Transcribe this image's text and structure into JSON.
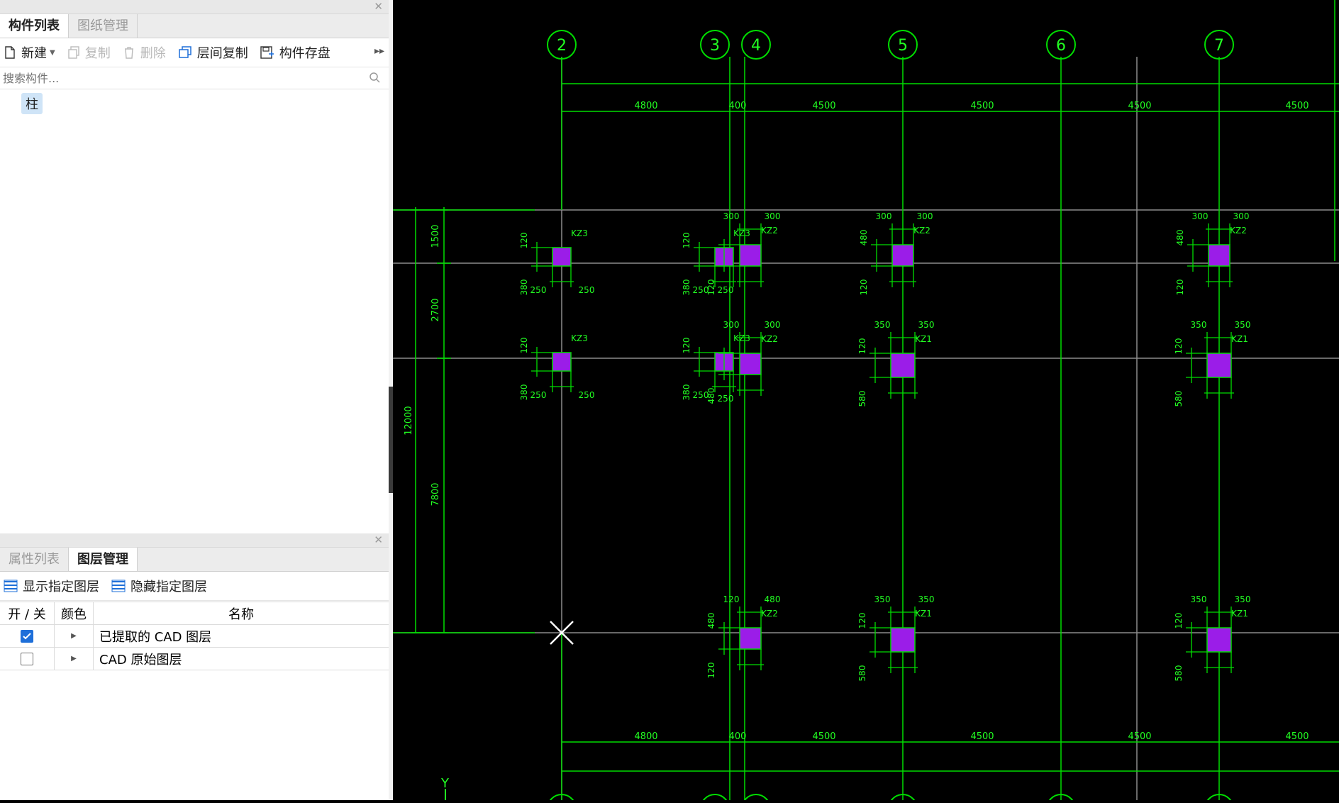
{
  "top_panel": {
    "tabs": [
      {
        "label": "构件列表",
        "active": true
      },
      {
        "label": "图纸管理",
        "active": false
      }
    ],
    "toolbar": {
      "new": "新建",
      "copy": "复制",
      "delete": "删除",
      "floor_copy": "层间复制",
      "save_component": "构件存盘"
    },
    "search_placeholder": "搜索构件...",
    "tree_item": "柱"
  },
  "bottom_panel": {
    "tabs": [
      {
        "label": "属性列表",
        "active": false
      },
      {
        "label": "图层管理",
        "active": true
      }
    ],
    "toolbar": {
      "show_layer": "显示指定图层",
      "hide_layer": "隐藏指定图层"
    },
    "table": {
      "headers": {
        "toggle": "开 / 关",
        "color": "颜色",
        "name": "名称"
      },
      "rows": [
        {
          "name": "已提取的 CAD 图层",
          "checked": true
        },
        {
          "name": "CAD 原始图层",
          "checked": false
        }
      ]
    }
  },
  "cad": {
    "axes": [
      "2",
      "3",
      "4",
      "5",
      "6",
      "7"
    ],
    "dims_top": [
      "4800",
      "400",
      "4500",
      "4500",
      "4500",
      "4500"
    ],
    "dims_bottom": [
      "4800",
      "400",
      "4500",
      "4500",
      "4500",
      "4500"
    ],
    "dims_left": [
      "1500",
      "2700",
      "12000",
      "7800"
    ],
    "y_label": "Y",
    "labels": {
      "n120": "120",
      "n250": "250",
      "n300": "300",
      "n350": "350",
      "n380": "380",
      "n480": "480",
      "n580": "580",
      "kz1": "KZ1",
      "kz2": "KZ2",
      "kz3": "KZ3"
    },
    "colors": {
      "line": "#00dd00",
      "text": "#22ff22",
      "column": "#9b1de8",
      "grid": "#8c8c8c",
      "background": "#000000"
    }
  }
}
